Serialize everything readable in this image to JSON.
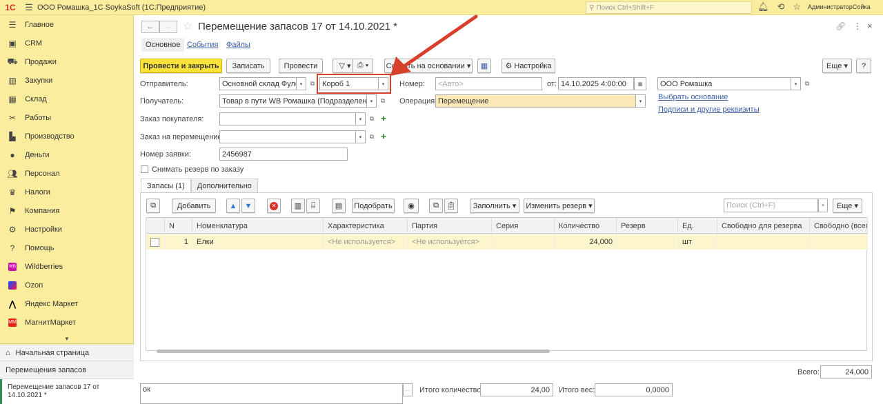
{
  "app": {
    "title": "ООО Ромашка_1С SoykaSoft  (1С:Предприятие)",
    "search_placeholder": "Поиск Ctrl+Shift+F",
    "user": "АдминистраторСойка"
  },
  "sidebar": {
    "items": [
      {
        "label": "Главное",
        "icon": "menu-icon"
      },
      {
        "label": "CRM",
        "icon": "crm-icon"
      },
      {
        "label": "Продажи",
        "icon": "cart-icon"
      },
      {
        "label": "Закупки",
        "icon": "purchases-icon"
      },
      {
        "label": "Склад",
        "icon": "warehouse-icon"
      },
      {
        "label": "Работы",
        "icon": "tools-icon"
      },
      {
        "label": "Производство",
        "icon": "factory-icon"
      },
      {
        "label": "Деньги",
        "icon": "money-icon"
      },
      {
        "label": "Персонал",
        "icon": "staff-icon"
      },
      {
        "label": "Налоги",
        "icon": "taxes-icon"
      },
      {
        "label": "Компания",
        "icon": "flag-icon"
      },
      {
        "label": "Настройки",
        "icon": "gear-icon"
      },
      {
        "label": "Помощь",
        "icon": "help-icon"
      },
      {
        "label": "Wildberries",
        "icon": "wildberries-icon"
      },
      {
        "label": "Ozon",
        "icon": "ozon-icon"
      },
      {
        "label": "Яндекс Маркет",
        "icon": "yandex-market-icon"
      },
      {
        "label": "МагнитМаркет",
        "icon": "magnit-market-icon"
      }
    ],
    "home": "Начальная страница",
    "section": "Перемещения запасов",
    "open_doc": "Перемещение запасов 17 от 14.10.2021 *"
  },
  "doc": {
    "title": "Перемещение запасов 17 от 14.10.2021 *",
    "tabs": [
      "Основное",
      "События",
      "Файлы"
    ]
  },
  "toolbar": {
    "post_close": "Провести и закрыть",
    "save": "Записать",
    "post": "Провести",
    "create_based": "Создать на основании",
    "settings": "Настройка",
    "more": "Еще",
    "help": "?"
  },
  "form": {
    "sender_label": "Отправитель:",
    "sender_value": "Основной склад Фулфи",
    "box_value": "Короб 1",
    "number_label": "Номер:",
    "number_placeholder": "<Авто>",
    "date_label": "от:",
    "date_value": "14.10.2025  4:00:00",
    "org_value": "ООО Ромашка",
    "receiver_label": "Получатель:",
    "receiver_value": "Товар в пути WB Ромашка (Подразделение WB)",
    "operation_label": "Операция:",
    "operation_value": "Перемещение",
    "choose_basis": "Выбрать основание",
    "signatures": "Подписи и другие реквизиты",
    "customer_order_label": "Заказ покупателя:",
    "move_order_label": "Заказ на перемещение:",
    "request_no_label": "Номер заявки:",
    "request_no_value": "2456987",
    "reserve_chk": "Снимать резерв по заказу"
  },
  "subtabs": [
    "Запасы (1)",
    "Дополнительно"
  ],
  "table_toolbar": {
    "add": "Добавить",
    "pick": "Подобрать",
    "fill": "Заполнить",
    "change_reserve": "Изменить резерв",
    "search_placeholder": "Поиск (Ctrl+F)",
    "more": "Еще"
  },
  "table": {
    "columns": [
      "N",
      "Номенклатура",
      "Характеристика",
      "Партия",
      "Серия",
      "Количество",
      "Резерв",
      "Ед.",
      "Свободно для резерва",
      "Свободно  (всего)"
    ],
    "rows": [
      {
        "n": "1",
        "item": "Елки",
        "char": "<Не используется>",
        "batch": "<Не используется>",
        "series": "",
        "qty": "24,000",
        "reserve": "",
        "unit": "шт",
        "free_reserve": "",
        "free_total": ""
      }
    ]
  },
  "footer": {
    "total_label": "Всего:",
    "total_value": "24,000",
    "comment": "ок",
    "total_qty_label": "Итого количество:",
    "total_qty_value": "24,00",
    "total_weight_label": "Итого вес:",
    "total_weight_value": "0,0000"
  },
  "annotation": {
    "arrow_color": "#d9402b"
  }
}
